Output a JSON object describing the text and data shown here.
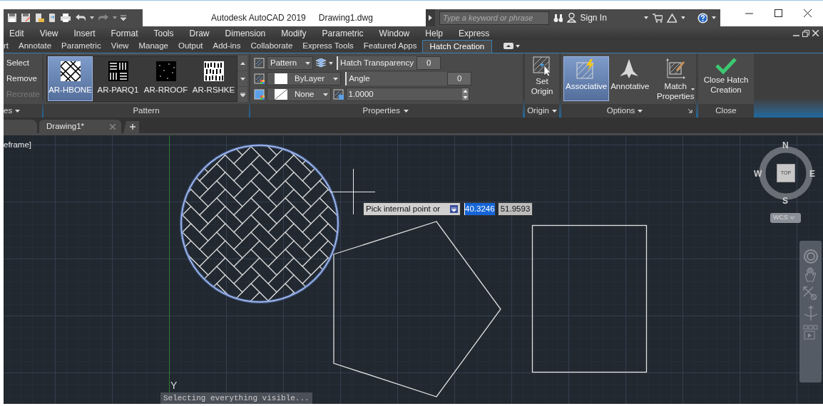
{
  "title_bar": {
    "app_title": "Autodesk AutoCAD 2019",
    "file_name": "Drawing1.dwg",
    "search_placeholder": "Type a keyword or phrase",
    "sign_in": "Sign In"
  },
  "menu_bar": [
    "Edit",
    "View",
    "Insert",
    "Format",
    "Tools",
    "Draw",
    "Dimension",
    "Modify",
    "Parametric",
    "Window",
    "Help",
    "Express"
  ],
  "ribbon_tabs": [
    {
      "label": "rt",
      "selected": false
    },
    {
      "label": "Annotate",
      "selected": false
    },
    {
      "label": "Parametric",
      "selected": false
    },
    {
      "label": "View",
      "selected": false
    },
    {
      "label": "Manage",
      "selected": false
    },
    {
      "label": "Output",
      "selected": false
    },
    {
      "label": "Add-ins",
      "selected": false
    },
    {
      "label": "Collaborate",
      "selected": false
    },
    {
      "label": "Express Tools",
      "selected": false
    },
    {
      "label": "Featured Apps",
      "selected": false
    },
    {
      "label": "Hatch Creation",
      "selected": true
    }
  ],
  "ribbon": {
    "boundaries_panel": {
      "items": [
        {
          "label": "Select",
          "disabled": false
        },
        {
          "label": "Remove",
          "disabled": false
        },
        {
          "label": "Recreate",
          "disabled": true
        }
      ],
      "title": "es"
    },
    "pattern_panel": {
      "patterns": [
        {
          "label": "AR-HBONE",
          "selected": true,
          "kind": "hbone"
        },
        {
          "label": "AR-PARQ1",
          "selected": false,
          "kind": "parq"
        },
        {
          "label": "AR-RROOF",
          "selected": false,
          "kind": "rroof"
        },
        {
          "label": "AR-RSHKE",
          "selected": false,
          "kind": "rshke"
        }
      ],
      "title": "Pattern"
    },
    "properties_panel": {
      "hatch_type": "Pattern",
      "hatch_color": "ByLayer",
      "background_color": "None",
      "transparency_label": "Hatch Transparency",
      "transparency_value": "0",
      "angle_label": "Angle",
      "angle_value": "0",
      "scale": "1.0000",
      "title": "Properties"
    },
    "origin_panel": {
      "button": "Set Origin",
      "title": "Origin"
    },
    "options_panel": {
      "buttons": [
        {
          "label": "Associative",
          "selected": true,
          "kind": "associative"
        },
        {
          "label": "Annotative",
          "selected": false,
          "kind": "annotative"
        },
        {
          "label": "Match Properties",
          "selected": false,
          "kind": "match"
        }
      ],
      "title": "Options"
    },
    "close_panel": {
      "button": "Close Hatch Creation",
      "title": "Close"
    }
  },
  "file_tabs": [
    {
      "label": "Drawing1*",
      "selected": true
    }
  ],
  "viewport": {
    "view_label": "eframe]",
    "tooltip": {
      "prompt": "Pick internal point or",
      "x_value": "40.3246",
      "y_value": "51.9593"
    },
    "axis_label": "Y",
    "compass": {
      "north": "N",
      "south": "S",
      "east": "E",
      "west": "W",
      "top": "TOP"
    },
    "ucs": "WCS",
    "command_line": "Selecting everything visible..."
  }
}
